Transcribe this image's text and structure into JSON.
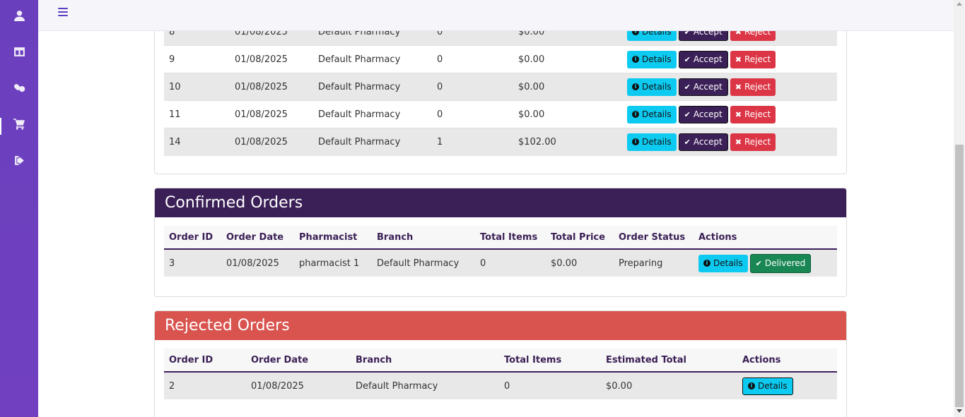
{
  "sidebar": {
    "items": [
      {
        "icon": "user-icon"
      },
      {
        "icon": "dashboard-icon"
      },
      {
        "icon": "pills-icon"
      },
      {
        "icon": "cart-icon"
      },
      {
        "icon": "logout-icon"
      }
    ]
  },
  "pending": {
    "columns_hidden": true,
    "rows": [
      {
        "id": "8",
        "date": "01/08/2025",
        "branch": "Default Pharmacy",
        "items": "0",
        "total": "$0.00"
      },
      {
        "id": "9",
        "date": "01/08/2025",
        "branch": "Default Pharmacy",
        "items": "0",
        "total": "$0.00"
      },
      {
        "id": "10",
        "date": "01/08/2025",
        "branch": "Default Pharmacy",
        "items": "0",
        "total": "$0.00"
      },
      {
        "id": "11",
        "date": "01/08/2025",
        "branch": "Default Pharmacy",
        "items": "0",
        "total": "$0.00"
      },
      {
        "id": "14",
        "date": "01/08/2025",
        "branch": "Default Pharmacy",
        "items": "1",
        "total": "$102.00"
      }
    ],
    "details_label": "Details",
    "accept_label": "Accept",
    "reject_label": "Reject"
  },
  "confirmed": {
    "title": "Confirmed Orders",
    "header_color": "#3b1f57",
    "columns": [
      "Order ID",
      "Order Date",
      "Pharmacist",
      "Branch",
      "Total Items",
      "Total Price",
      "Order Status",
      "Actions"
    ],
    "rows": [
      {
        "id": "3",
        "date": "01/08/2025",
        "pharmacist": "pharmacist 1",
        "branch": "Default Pharmacy",
        "items": "0",
        "total": "$0.00",
        "status": "Preparing"
      }
    ],
    "details_label": "Details",
    "delivered_label": "Delivered"
  },
  "rejected": {
    "title": "Rejected Orders",
    "header_color": "#d9534f",
    "columns": [
      "Order ID",
      "Order Date",
      "Branch",
      "Total Items",
      "Estimated Total",
      "Actions"
    ],
    "rows": [
      {
        "id": "2",
        "date": "01/08/2025",
        "branch": "Default Pharmacy",
        "items": "0",
        "total": "$0.00"
      }
    ],
    "details_label": "Details"
  }
}
